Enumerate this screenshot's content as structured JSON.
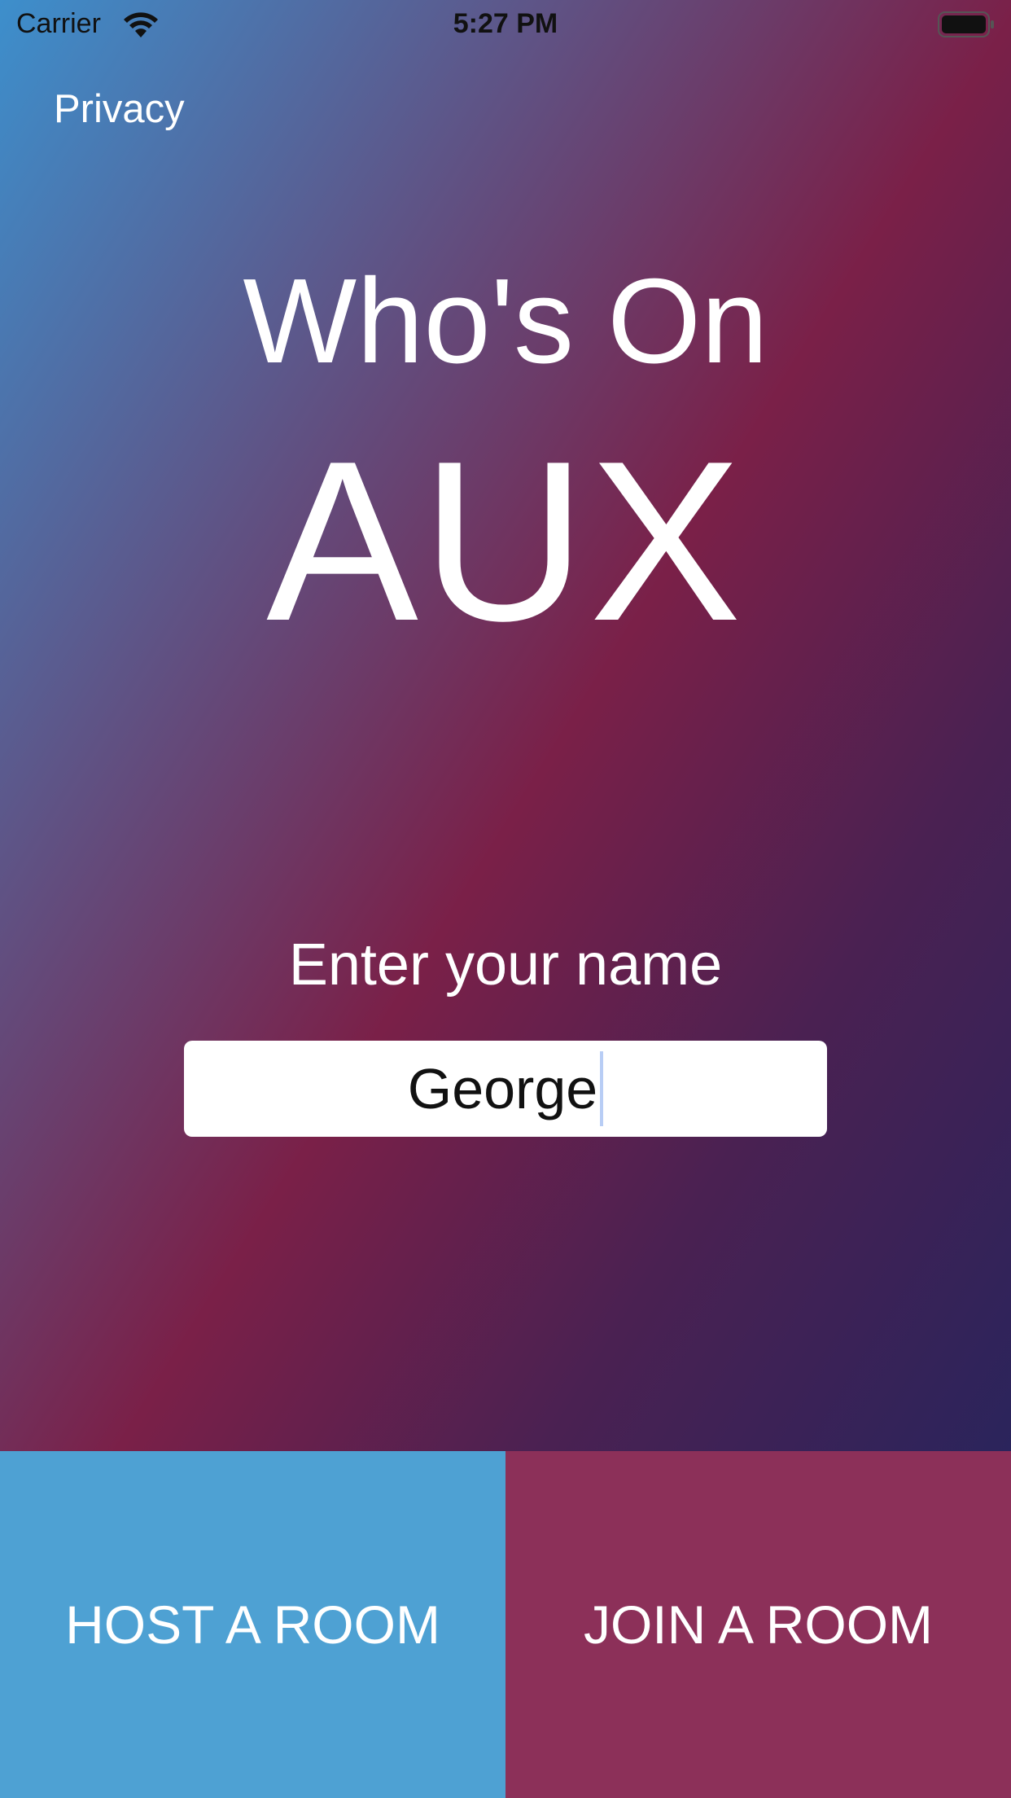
{
  "status_bar": {
    "carrier": "Carrier",
    "time": "5:27 PM",
    "wifi_icon": "wifi-icon",
    "battery_icon": "battery-icon"
  },
  "nav": {
    "privacy_label": "Privacy"
  },
  "title": {
    "line1": "Who's On",
    "line2": "AUX"
  },
  "name_form": {
    "prompt": "Enter your name",
    "value": "George"
  },
  "actions": {
    "host_label": "HOST A ROOM",
    "join_label": "JOIN A ROOM"
  },
  "colors": {
    "host_button": "#4ea1d3",
    "join_button": "#8c3059",
    "gradient_start": "#3d8fcc",
    "gradient_mid": "#7a2048",
    "gradient_end": "#1c2560"
  }
}
